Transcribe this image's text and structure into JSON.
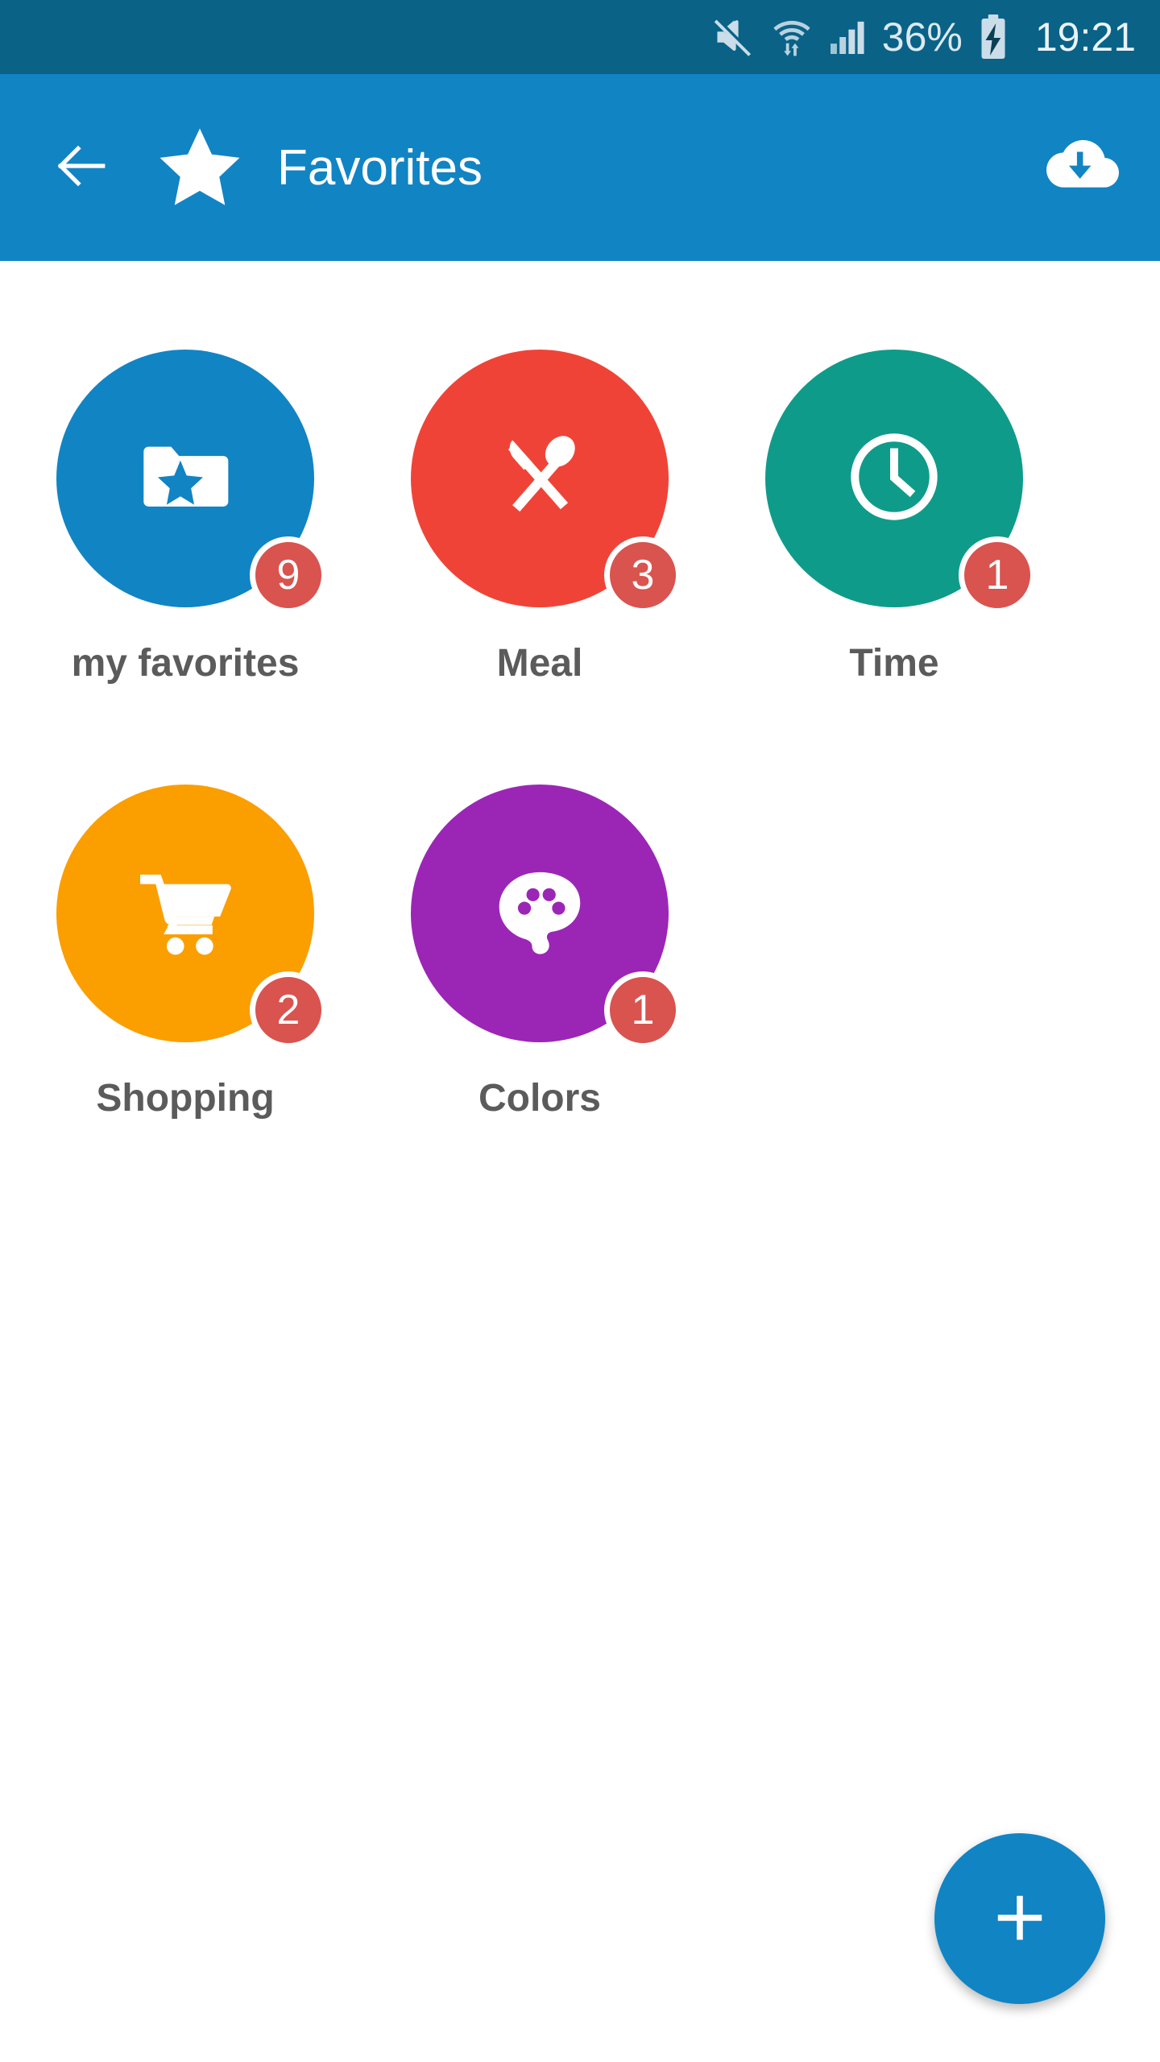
{
  "status_bar": {
    "background_color": "#0A6287",
    "mute_icon": "mute-icon",
    "wifi_icon": "wifi-data-transfer-icon",
    "signal_icon": "cellular-signal-icon",
    "battery_percent": "36%",
    "battery_icon": "battery-charging-icon",
    "clock": "19:21"
  },
  "app_bar": {
    "background_color": "#1184C4",
    "back_icon": "back-arrow-icon",
    "brand_icon": "star-icon",
    "title": "Favorites",
    "action_icon": "cloud-download-icon"
  },
  "tiles": [
    {
      "label": "my favorites",
      "badge": "9",
      "color": "#1184C4",
      "icon": "folder-star-icon"
    },
    {
      "label": "Meal",
      "badge": "3",
      "color": "#F04337",
      "icon": "cutlery-icon"
    },
    {
      "label": "Time",
      "badge": "1",
      "color": "#0F9B8A",
      "icon": "clock-icon"
    },
    {
      "label": "Shopping",
      "badge": "2",
      "color": "#FB9E00",
      "icon": "shopping-cart-icon"
    },
    {
      "label": "Colors",
      "badge": "1",
      "color": "#9B26B6",
      "icon": "paint-palette-icon"
    }
  ],
  "fab": {
    "icon": "plus-icon",
    "label": "+",
    "color": "#1184C4"
  },
  "theme": {
    "badge_color": "#D9534F",
    "label_color": "#5B5B5B",
    "page_background": "#FFFFFF"
  }
}
